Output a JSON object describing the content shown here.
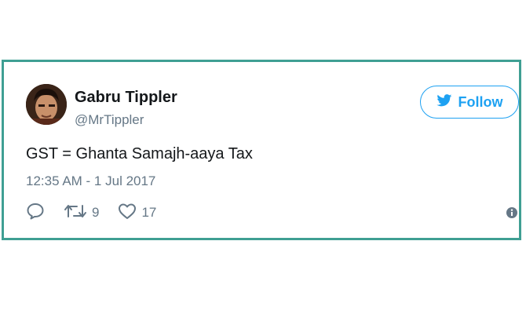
{
  "user": {
    "display_name": "Gabru Tippler",
    "handle": "@MrTippler",
    "avatar_icon": "profile-photo"
  },
  "follow_button": {
    "label": "Follow",
    "icon": "twitter-bird-icon",
    "accent_color": "#1da1f2"
  },
  "tweet": {
    "text": "GST = Ghanta Samajh-aaya Tax",
    "timestamp": "12:35 AM - 1 Jul 2017"
  },
  "actions": {
    "reply_icon": "reply-icon",
    "retweet_icon": "retweet-icon",
    "retweet_count": "9",
    "like_icon": "heart-icon",
    "like_count": "17",
    "info_icon": "info-icon"
  },
  "colors": {
    "card_border": "#3f9f93",
    "text_primary": "#14171a",
    "text_secondary": "#657786"
  }
}
